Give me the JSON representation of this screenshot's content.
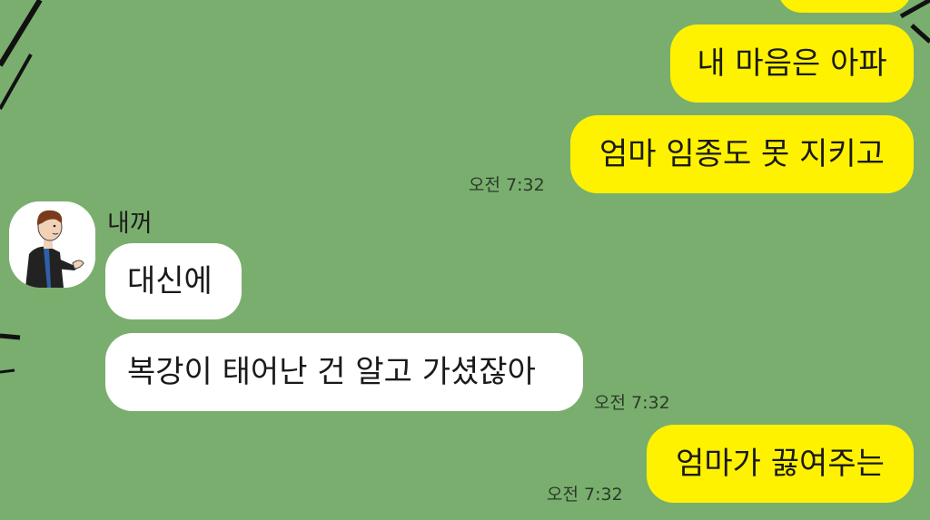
{
  "colors": {
    "background": "#7aae6e",
    "outgoing_bubble": "#fff200",
    "incoming_bubble": "#ffffff"
  },
  "chat": {
    "sender_name": "내꺼",
    "messages": [
      {
        "direction": "out",
        "text": "내 마음은 아파"
      },
      {
        "direction": "out",
        "text": "엄마 임종도 못 지키고",
        "time": "오전 7:32"
      },
      {
        "direction": "in",
        "text": "대신에"
      },
      {
        "direction": "in",
        "text": "복강이 태어난 건 알고 가셨잖아",
        "time": "오전 7:32"
      },
      {
        "direction": "out",
        "text": "엄마가 끓여주는",
        "time": "오전 7:32"
      }
    ]
  }
}
